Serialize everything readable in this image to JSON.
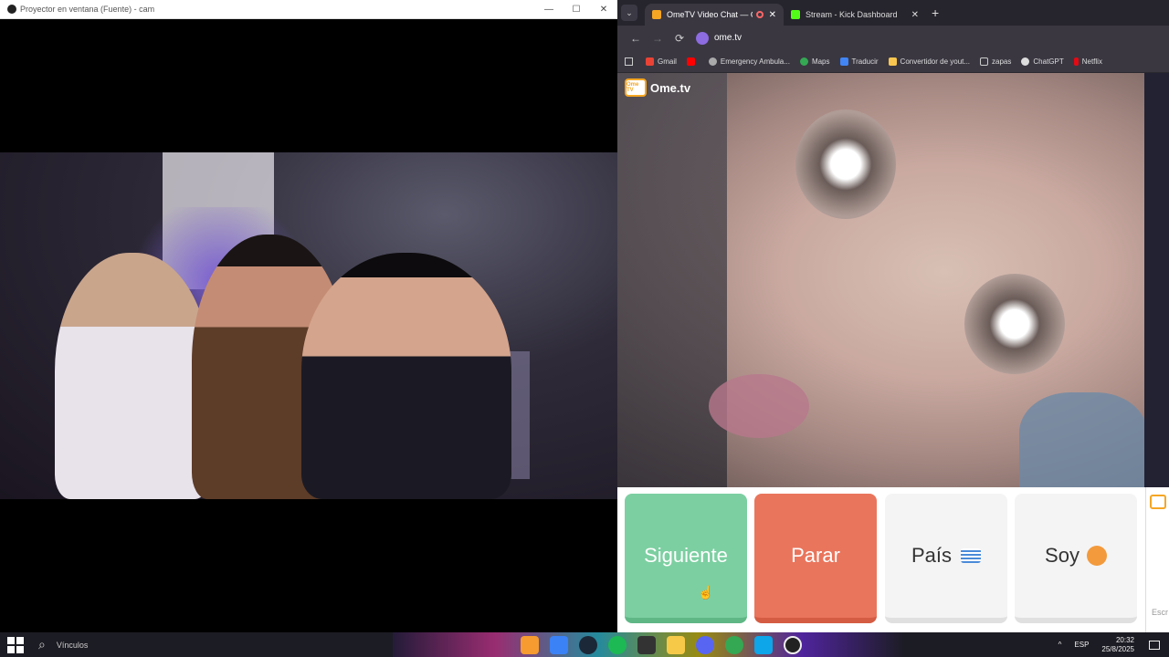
{
  "projector": {
    "title": "Proyector en ventana (Fuente) - cam",
    "minimize": "—",
    "maximize": "☐",
    "close": "✕"
  },
  "browser": {
    "tab_menu": "⌄",
    "tabs": [
      {
        "label": "OmeTV Video Chat — Ome",
        "fav_color": "#f5a623"
      },
      {
        "label": "Stream - Kick Dashboard",
        "fav_color": "#53fc18"
      }
    ],
    "tab_close": "✕",
    "new_tab": "+",
    "nav": {
      "back": "←",
      "forward": "→",
      "reload": "⟳"
    },
    "url": "ome.tv",
    "bookmarks": [
      {
        "label": "Gmail",
        "color": "#ea4335"
      },
      {
        "label": "",
        "color": "#ff0000"
      },
      {
        "label": "Emergency Ambula...",
        "color": "#aaaaaa"
      },
      {
        "label": "Maps",
        "color": "#34a853"
      },
      {
        "label": "Traducir",
        "color": "#4285f4"
      },
      {
        "label": "Convertidor de yout...",
        "color": "#f9c74f"
      },
      {
        "label": "zapas",
        "color": "#cccccc"
      },
      {
        "label": "ChatGPT",
        "color": "#dddddd"
      },
      {
        "label": "Netflix",
        "color": "#e50914"
      }
    ]
  },
  "ometv": {
    "logo_text": "Ome.tv",
    "logo_badge": "Ome TV",
    "buttons": {
      "next": "Siguiente",
      "stop": "Parar",
      "country": "País",
      "me": "Soy"
    },
    "chat_placeholder": "Escr"
  },
  "taskbar": {
    "search_label": "Vínculos",
    "language": "ESP",
    "time": "20:32",
    "date": "25/8/2025",
    "tray_arrow": "^"
  }
}
